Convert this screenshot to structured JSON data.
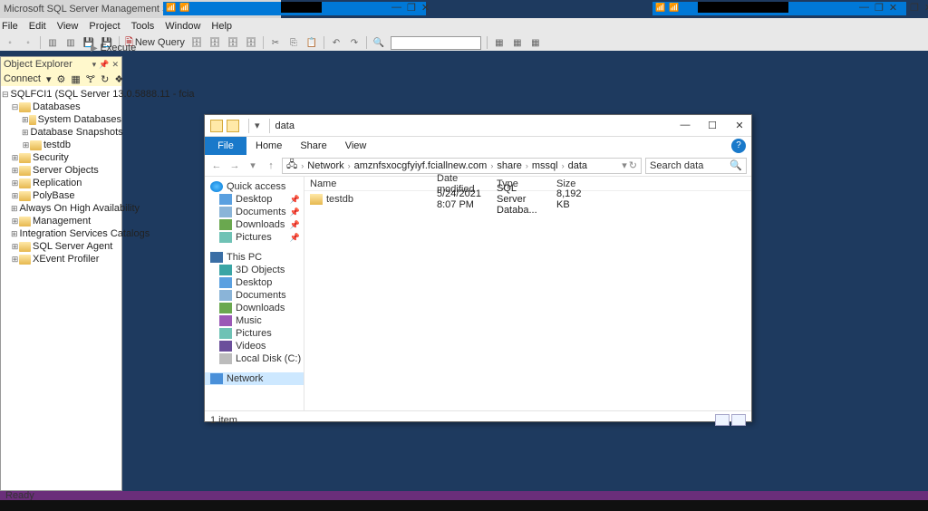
{
  "ssms_title": "Microsoft SQL Server Management Studio (Administrator)",
  "menu": {
    "file": "File",
    "edit": "Edit",
    "view": "View",
    "project": "Project",
    "tools": "Tools",
    "window": "Window",
    "help": "Help"
  },
  "toolbar": {
    "new_query": "New Query",
    "execute": "Execute"
  },
  "object_explorer": {
    "title": "Object Explorer",
    "connect": "Connect",
    "server": "SQLFCI1 (SQL Server 13.0.5888.11 - fcia",
    "nodes": {
      "databases": "Databases",
      "sysdb": "System Databases",
      "snap": "Database Snapshots",
      "testdb": "testdb",
      "security": "Security",
      "serverobj": "Server Objects",
      "repl": "Replication",
      "polybase": "PolyBase",
      "aoha": "Always On High Availability",
      "mgmt": "Management",
      "isc": "Integration Services Catalogs",
      "agent": "SQL Server Agent",
      "xe": "XEvent Profiler"
    }
  },
  "explorer": {
    "title": "data",
    "ribbon": {
      "file": "File",
      "home": "Home",
      "share": "Share",
      "view": "View"
    },
    "path": {
      "network": "Network",
      "host": "amznfsxocgfyiyf.fciallnew.com",
      "share": "share",
      "mssql": "mssql",
      "data": "data"
    },
    "search_placeholder": "Search data",
    "columns": {
      "name": "Name",
      "date": "Date modified",
      "type": "Type",
      "size": "Size"
    },
    "row": {
      "name": "testdb",
      "date": "5/24/2021 8:07 PM",
      "type": "SQL Server Databa...",
      "size": "8,192 KB"
    },
    "status": "1 item",
    "nav": {
      "quick": "Quick access",
      "desktop": "Desktop",
      "documents": "Documents",
      "downloads": "Downloads",
      "pictures": "Pictures",
      "thispc": "This PC",
      "obj3d": "3D Objects",
      "music": "Music",
      "videos": "Videos",
      "local": "Local Disk (C:)",
      "network": "Network"
    }
  },
  "statusbar": "Ready"
}
